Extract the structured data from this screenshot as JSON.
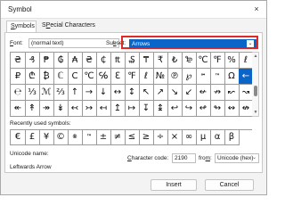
{
  "window": {
    "title": "Symbol",
    "close_icon": "×"
  },
  "tabs": [
    {
      "label": "Symbols",
      "accel": "S",
      "rest": "ymbols",
      "active": true
    },
    {
      "label": "Special Characters",
      "accel": "P",
      "prefix": "S",
      "rest": "ecial Characters",
      "active": false
    }
  ],
  "font": {
    "label_accel": "F",
    "label_rest": "ont:",
    "value": "(normal text)"
  },
  "subset": {
    "label_prefix": "Su",
    "label_accel": "b",
    "label_rest": "set:",
    "value": "Arrows"
  },
  "symbol_grid": {
    "rows": [
      [
        "₴",
        "₰",
        "₱",
        "₲",
        "₳",
        "₴",
        "₵",
        "₶",
        "₷",
        "₸",
        "₹",
        "₺",
        "₻",
        "℃",
        "℉",
        "%",
        "ℓ"
      ],
      [
        "₽",
        "₾",
        "₿",
        "ℂ",
        "C",
        "℃",
        "℅",
        "ℇ",
        "℉",
        "ℓ",
        "№",
        "℗",
        "℘",
        "℠",
        "™",
        "Ω",
        "←"
      ],
      [
        "℮",
        "⅓",
        "ℳ",
        "⅔",
        "↑",
        "→",
        "↓",
        "↔",
        "↕",
        "↖",
        "↗",
        "↘",
        "↙",
        "↚",
        "↛",
        "↜",
        "↝"
      ],
      [
        "↞",
        "↟",
        "↠",
        "↡",
        "↢",
        "↣",
        "↤",
        "↥",
        "↦",
        "↧",
        "↨",
        "↩",
        "↪",
        "↫",
        "↬",
        "↭",
        "↮"
      ]
    ]
  },
  "recent": {
    "label_prefix": "Recently used symbols:",
    "symbols": [
      "€",
      "£",
      "¥",
      "©",
      "®",
      "™",
      "±",
      "≠",
      "≤",
      "≥",
      "÷",
      "×",
      "∞",
      "µ",
      "α",
      "β"
    ]
  },
  "unicode_name": {
    "label": "Unicode name:",
    "value": "Leftwards Arrow"
  },
  "character_code": {
    "label_prefix": "",
    "label_accel": "C",
    "label_rest": "haracter code:",
    "value": "2190"
  },
  "from": {
    "label_prefix": "fro",
    "label_accel": "m",
    "label_rest": ":",
    "value": "Unicode (hex)"
  },
  "buttons": {
    "insert": "Insert",
    "cancel": "Cancel"
  },
  "colors": {
    "selection": "#0b64c8",
    "highlight_border": "#e02a2a"
  }
}
